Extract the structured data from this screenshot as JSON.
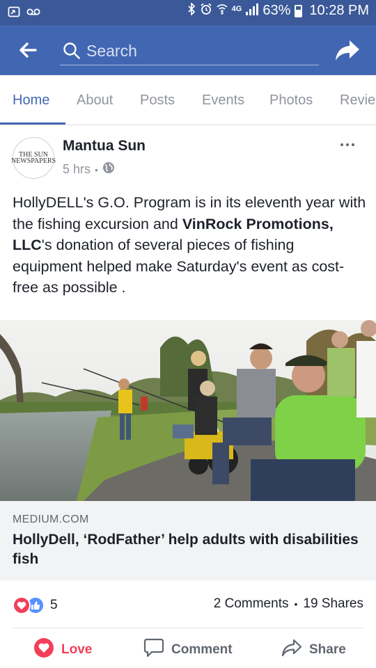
{
  "status_bar": {
    "battery": "63%",
    "time": "10:28 PM",
    "network": "4G",
    "battery_level": 0.63
  },
  "header": {
    "search_placeholder": "Search"
  },
  "tabs": [
    {
      "label": "Home",
      "active": true
    },
    {
      "label": "About"
    },
    {
      "label": "Posts"
    },
    {
      "label": "Events"
    },
    {
      "label": "Photos"
    },
    {
      "label": "Revie"
    }
  ],
  "post": {
    "author": "Mantua Sun",
    "avatar_text": [
      "THE SUN",
      "NEWSPAPERS"
    ],
    "time": "5 hrs",
    "text_parts": [
      "HollyDELL's G.O. Program is in its eleventh year with the fishing excursion and ",
      "VinRock Promotions, LLC",
      "'s donation of several pieces of fishing equipment helped make Saturday's event as cost-free as possible ."
    ],
    "link": {
      "domain": "MEDIUM.COM",
      "title": "HollyDell, ‘RodFather’ help adults with disabilities fish"
    },
    "reactions_count": "5",
    "comments": "2 Comments",
    "separator": "•",
    "shares": "19 Shares"
  },
  "actions": {
    "love": "Love",
    "comment": "Comment",
    "share": "Share"
  },
  "colors": {
    "brand_blue": "#4267b2",
    "status_blue": "#3b5998",
    "love_red": "#f33e58",
    "like_blue": "#5890ff"
  }
}
